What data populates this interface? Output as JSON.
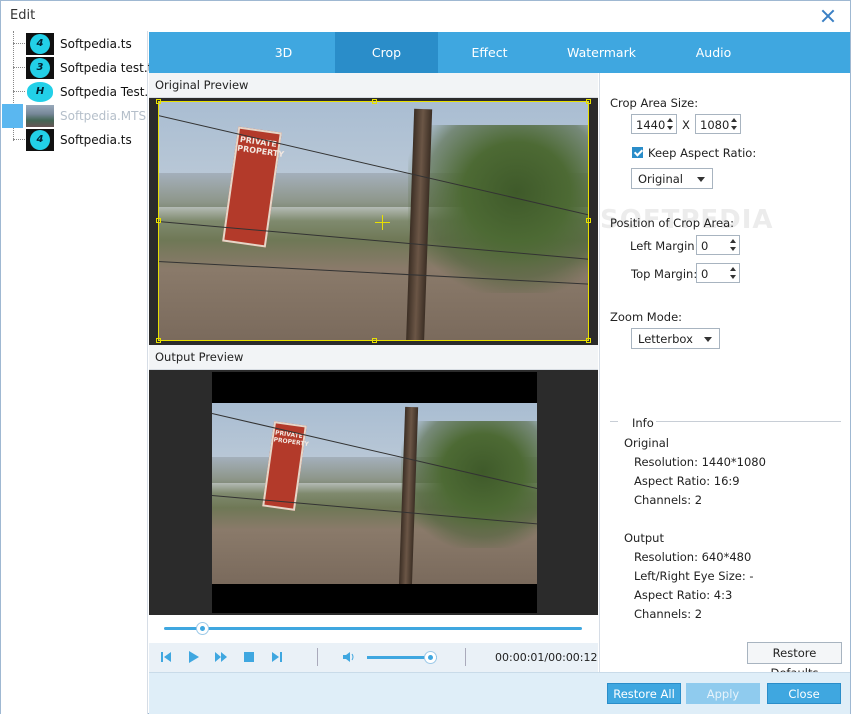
{
  "window": {
    "title": "Edit",
    "close_icon": "close-icon"
  },
  "sidebar": {
    "items": [
      {
        "label": "Softpedia.ts",
        "thumb_glyph": "4"
      },
      {
        "label": "Softpedia test.ts",
        "thumb_glyph": "3"
      },
      {
        "label": "Softpedia Test...",
        "thumb_glyph": "H"
      },
      {
        "label": "Softpedia.MTS",
        "thumb_glyph": ""
      },
      {
        "label": "Softpedia.ts",
        "thumb_glyph": "4"
      }
    ],
    "selected_index": 3
  },
  "tabs": [
    {
      "label": "3D"
    },
    {
      "label": "Crop"
    },
    {
      "label": "Effect"
    },
    {
      "label": "Watermark"
    },
    {
      "label": "Audio"
    }
  ],
  "active_tab": "Crop",
  "preview": {
    "original_label": "Original Preview",
    "output_label": "Output Preview",
    "sign_text": "PRIVATE PROPERTY"
  },
  "player": {
    "progress_fraction": 0.09,
    "volume_fraction": 0.9,
    "timecode": "00:00:01/00:00:12"
  },
  "crop": {
    "area_size_label": "Crop Area Size:",
    "width": "1440",
    "x_label": "X",
    "height": "1080",
    "keep_aspect_label": "Keep Aspect Ratio:",
    "keep_aspect_checked": true,
    "aspect_value": "Original",
    "position_label": "Position of Crop Area:",
    "left_margin_label": "Left Margin:",
    "left_margin": "0",
    "top_margin_label": "Top Margin:",
    "top_margin": "0",
    "zoom_mode_label": "Zoom Mode:",
    "zoom_mode": "Letterbox"
  },
  "info": {
    "header": "Info",
    "original_header": "Original",
    "original_resolution": "Resolution: 1440*1080",
    "original_aspect": "Aspect Ratio: 16:9",
    "original_channels": "Channels: 2",
    "output_header": "Output",
    "output_resolution": "Resolution: 640*480",
    "output_eye_size": "Left/Right Eye Size: -",
    "output_aspect": "Aspect Ratio: 4:3",
    "output_channels": "Channels: 2"
  },
  "buttons": {
    "restore_defaults": "Restore Defaults",
    "restore_all": "Restore All",
    "apply": "Apply",
    "close": "Close"
  },
  "watermark_text": "SOFTPEDIA",
  "colors": {
    "accent": "#3fa7e0",
    "accent_dark": "#2a8dc9",
    "crop_border": "#e8e000"
  }
}
